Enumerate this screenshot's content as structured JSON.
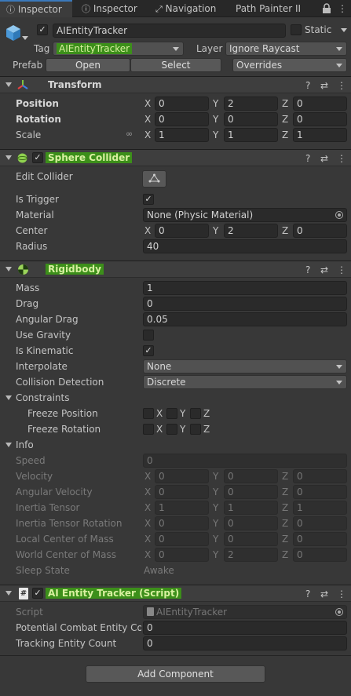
{
  "tabs": [
    {
      "label": "Inspector"
    },
    {
      "label": "Inspector"
    },
    {
      "label": "Navigation"
    },
    {
      "label": "Path Painter II"
    }
  ],
  "gameobject": {
    "name": "AIEntityTracker",
    "static_label": "Static",
    "tag_label": "Tag",
    "tag_value": "AIEntityTracker",
    "layer_label": "Layer",
    "layer_value": "Ignore Raycast",
    "prefab_label": "Prefab",
    "open_label": "Open",
    "select_label": "Select",
    "overrides_label": "Overrides"
  },
  "transform": {
    "title": "Transform",
    "position_label": "Position",
    "rotation_label": "Rotation",
    "scale_label": "Scale",
    "axis_x": "X",
    "axis_y": "Y",
    "axis_z": "Z",
    "position": {
      "x": "0",
      "y": "2",
      "z": "0"
    },
    "rotation": {
      "x": "0",
      "y": "0",
      "z": "0"
    },
    "scale": {
      "x": "1",
      "y": "1",
      "z": "1"
    }
  },
  "sphere_collider": {
    "title": "Sphere Collider",
    "edit_collider_label": "Edit Collider",
    "is_trigger_label": "Is Trigger",
    "material_label": "Material",
    "material_value": "None (Physic Material)",
    "center_label": "Center",
    "center": {
      "x": "0",
      "y": "2",
      "z": "0"
    },
    "radius_label": "Radius",
    "radius_value": "40"
  },
  "rigidbody": {
    "title": "Rigidbody",
    "mass_label": "Mass",
    "mass_value": "1",
    "drag_label": "Drag",
    "drag_value": "0",
    "angular_drag_label": "Angular Drag",
    "angular_drag_value": "0.05",
    "use_gravity_label": "Use Gravity",
    "is_kinematic_label": "Is Kinematic",
    "interpolate_label": "Interpolate",
    "interpolate_value": "None",
    "collision_detection_label": "Collision Detection",
    "collision_detection_value": "Discrete",
    "constraints_label": "Constraints",
    "freeze_position_label": "Freeze Position",
    "freeze_rotation_label": "Freeze Rotation",
    "info_label": "Info",
    "speed_label": "Speed",
    "speed_value": "0",
    "velocity_label": "Velocity",
    "velocity": {
      "x": "0",
      "y": "0",
      "z": "0"
    },
    "angular_velocity_label": "Angular Velocity",
    "angular_velocity": {
      "x": "0",
      "y": "0",
      "z": "0"
    },
    "inertia_tensor_label": "Inertia Tensor",
    "inertia_tensor": {
      "x": "1",
      "y": "1",
      "z": "1"
    },
    "inertia_tensor_rotation_label": "Inertia Tensor Rotation",
    "inertia_tensor_rotation": {
      "x": "0",
      "y": "0",
      "z": "0"
    },
    "local_com_label": "Local Center of Mass",
    "local_com": {
      "x": "0",
      "y": "0",
      "z": "0"
    },
    "world_com_label": "World Center of Mass",
    "world_com": {
      "x": "0",
      "y": "2",
      "z": "0"
    },
    "sleep_state_label": "Sleep State",
    "sleep_state_value": "Awake"
  },
  "script_component": {
    "title": "AI Entity Tracker (Script)",
    "script_label": "Script",
    "script_value": "AIEntityTracker",
    "potential_label": "Potential Combat Entity Coun",
    "potential_value": "0",
    "tracking_label": "Tracking Entity Count",
    "tracking_value": "0"
  },
  "add_component_label": "Add Component",
  "colors": {
    "background": "#383838",
    "highlight": "#3c8f1a",
    "accent": "#3a79bb"
  },
  "icons": [
    "lock-icon",
    "menu-icon",
    "help-icon",
    "preset-icon",
    "kebab-icon",
    "gameobject-cube-icon",
    "transform-icon",
    "sphere-collider-icon",
    "rigidbody-icon",
    "script-icon",
    "link-icon"
  ]
}
